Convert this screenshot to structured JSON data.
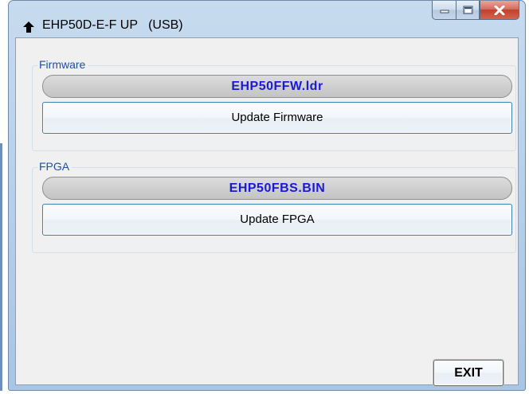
{
  "window": {
    "title": "EHP50D-E-F UP   (USB)",
    "icons": {
      "app": "up-arrow-icon",
      "minimize": "minimize-icon",
      "maximize": "maximize-icon",
      "close": "close-icon"
    }
  },
  "firmware": {
    "group_label": "Firmware",
    "filename": "EHP50FFW.ldr",
    "update_label": "Update Firmware"
  },
  "fpga": {
    "group_label": "FPGA",
    "filename": "EHP50FBS.BIN",
    "update_label": "Update FPGA"
  },
  "exit_label": "EXIT",
  "colors": {
    "filename_text": "#1a1ad6",
    "group_label": "#1e4fa8",
    "close_button": "#c0412c",
    "button_border": "#3c7fb1"
  }
}
